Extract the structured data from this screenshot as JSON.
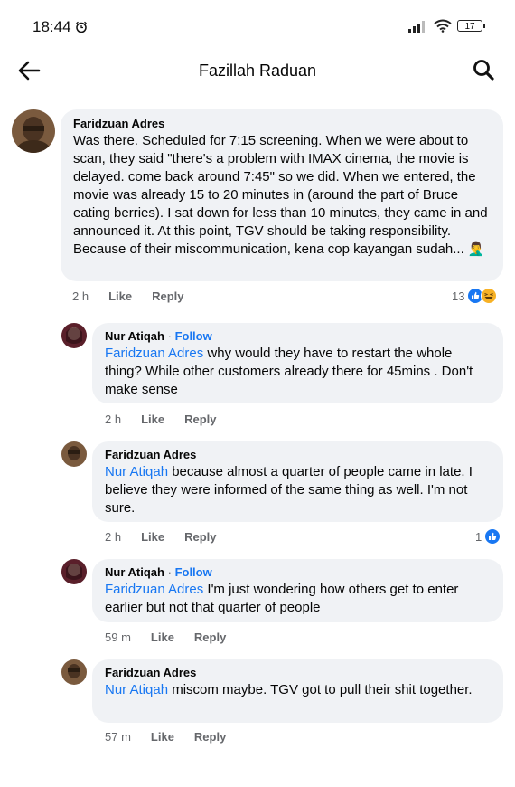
{
  "status": {
    "time": "18:44",
    "battery": "17"
  },
  "header": {
    "title": "Fazillah Raduan"
  },
  "comments": [
    {
      "author": "Faridzuan Adres",
      "mention": "",
      "text": "Was there. Scheduled for 7:15 screening. When we were about to scan, they said \"there's a problem with IMAX cinema, the movie is delayed. come back around 7:45\" so we did. When we entered, the movie was already 15 to 20 minutes in (around the part of Bruce eating berries). I sat down for less than 10 minutes, they came in and announced it. At this point, TGV should be taking responsibility. Because of their miscommunication, kena cop kayangan sudah...",
      "emoji": "🤦‍♂️",
      "time": "2 h",
      "like": "Like",
      "reply": "Reply",
      "reaction_count": "13"
    },
    {
      "author": "Nur Atiqah",
      "follow_sep": "·",
      "follow": "Follow",
      "mention": "Faridzuan Adres",
      "text": " why would they have to restart the whole thing? While other customers already there for 45mins . Don't make sense",
      "time": "2 h",
      "like": "Like",
      "reply": "Reply"
    },
    {
      "author": "Faridzuan Adres",
      "mention": "Nur Atiqah",
      "text": " because almost a quarter of people came in late. I believe they were informed of the same thing as well. I'm not sure.",
      "time": "2 h",
      "like": "Like",
      "reply": "Reply",
      "reaction_count": "1"
    },
    {
      "author": "Nur Atiqah",
      "follow_sep": "·",
      "follow": "Follow",
      "mention": "Faridzuan Adres",
      "text": " I'm just wondering how others get to enter earlier but not that quarter of people",
      "time": "59 m",
      "like": "Like",
      "reply": "Reply"
    },
    {
      "author": "Faridzuan Adres",
      "mention": "Nur Atiqah",
      "text": " miscom maybe. TGV got to pull their shit together.",
      "time": "57 m",
      "like": "Like",
      "reply": "Reply"
    }
  ],
  "icons": {
    "back": "back-arrow-icon",
    "search": "search-icon",
    "like_reaction": "like-reaction-icon",
    "haha_reaction": "haha-reaction-icon"
  },
  "colors": {
    "bubble": "#f0f2f5",
    "link": "#1877f2",
    "meta": "#65676b"
  }
}
